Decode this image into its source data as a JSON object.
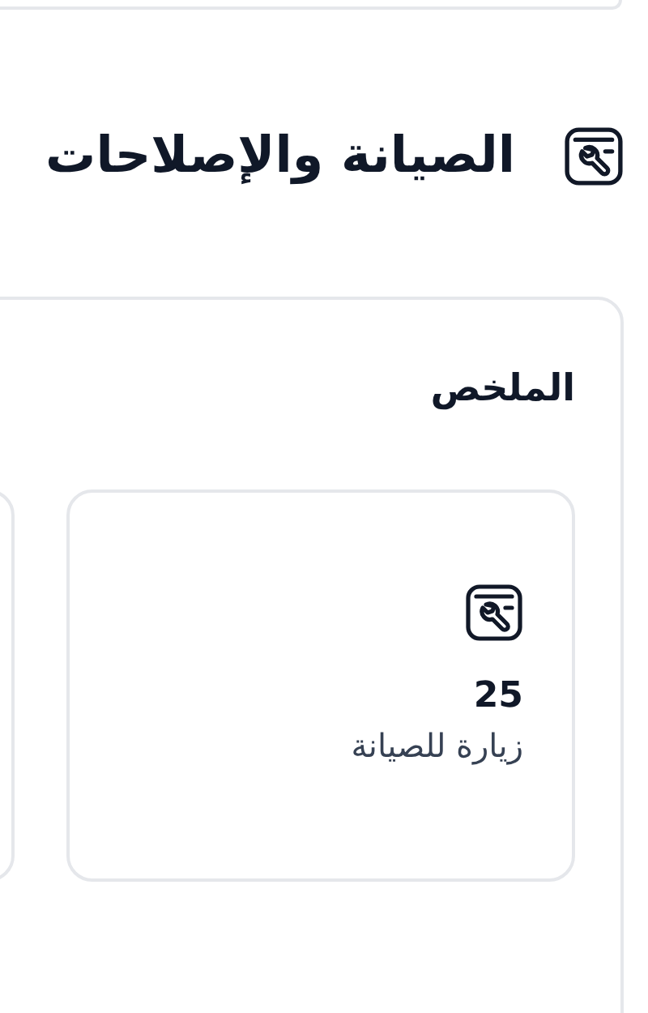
{
  "section": {
    "title": "الصيانة والإصلاحات"
  },
  "summary": {
    "title": "الملخص",
    "cards": [
      {
        "kind": "stat",
        "value": "25",
        "label": "زيارة للصيانة"
      },
      {
        "kind": "cutoff"
      }
    ]
  }
}
